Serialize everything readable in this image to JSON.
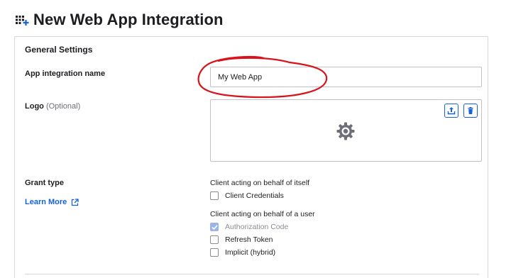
{
  "header": {
    "title": "New Web App Integration",
    "icon": "app-grid-add-icon"
  },
  "general_settings": {
    "title": "General Settings",
    "app_name": {
      "label": "App integration name",
      "value": "My Web App"
    },
    "logo": {
      "label": "Logo",
      "optional": "(Optional)",
      "upload_icon": "upload-icon",
      "delete_icon": "trash-icon",
      "placeholder_icon": "gear-icon"
    }
  },
  "grant_type": {
    "label": "Grant type",
    "learn_more": "Learn More",
    "self_group": {
      "label": "Client acting on behalf of itself",
      "options": [
        {
          "label": "Client Credentials",
          "checked": false
        }
      ]
    },
    "user_group": {
      "label": "Client acting on behalf of a user",
      "options": [
        {
          "label": "Authorization Code",
          "checked": true,
          "disabled": true
        },
        {
          "label": "Refresh Token",
          "checked": false
        },
        {
          "label": "Implicit (hybrid)",
          "checked": false
        }
      ]
    }
  },
  "colors": {
    "accent": "#1662dd",
    "annotation": "#d8131b",
    "border": "#c1c1c8"
  }
}
